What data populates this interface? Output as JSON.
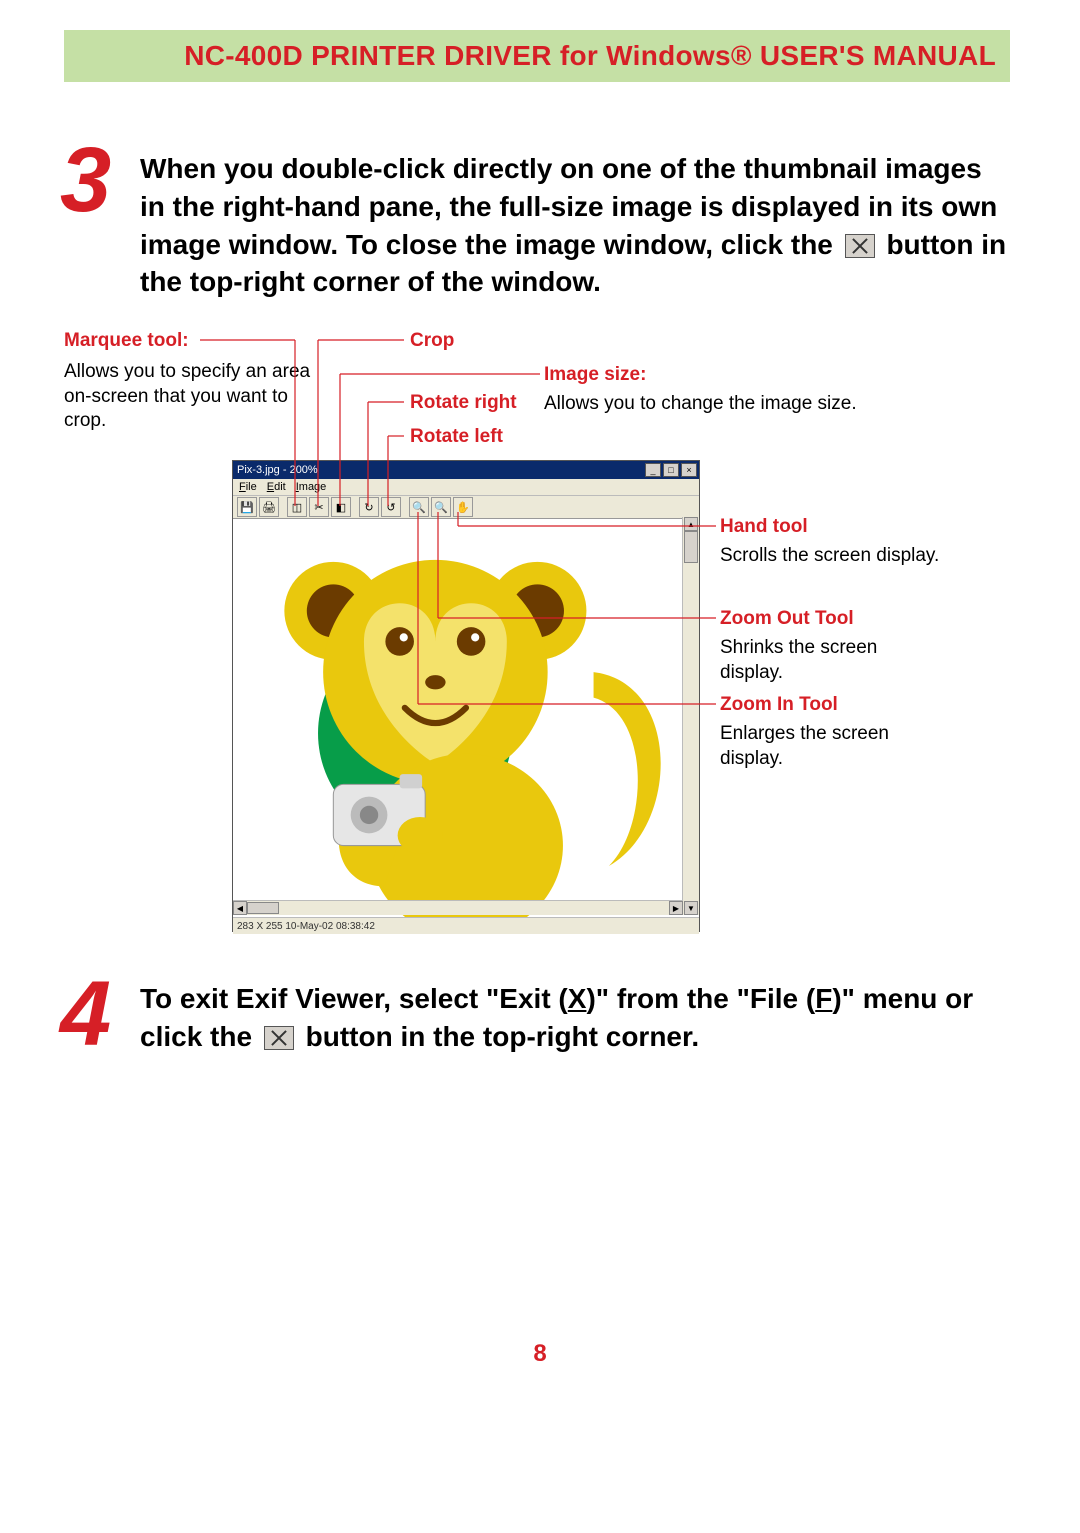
{
  "header": {
    "title": "NC-400D PRINTER DRIVER for Windows® USER'S MANUAL"
  },
  "step3": {
    "number": "3",
    "text_before_icon": "When you double-click directly on one of the thumbnail images in the right-hand pane, the full-size image is displayed in its own image window. To close the image window, click the ",
    "text_after_icon": " button in the top-right corner of the window."
  },
  "step4": {
    "number": "4",
    "text_prefix": "To exit Exif Viewer, select \"Exit (",
    "exit_key": "X",
    "text_mid1": ")\" from the \"File (",
    "file_key": "F",
    "text_mid2": ")\" menu or click the ",
    "text_suffix": " button in the top-right corner."
  },
  "labels": {
    "marquee": {
      "title": "Marquee tool:",
      "desc": "Allows you to specify an area on-screen that you want to crop."
    },
    "crop": {
      "title": "Crop"
    },
    "rotr": {
      "title": "Rotate right"
    },
    "rotl": {
      "title": "Rotate left"
    },
    "imgsize": {
      "title": "Image size:",
      "desc": "Allows you to change the image size."
    },
    "hand": {
      "title": "Hand tool",
      "desc": "Scrolls the screen display."
    },
    "zoomout": {
      "title": "Zoom Out Tool",
      "desc": "Shrinks the screen display."
    },
    "zoomin": {
      "title": "Zoom In Tool",
      "desc": "Enlarges the screen display."
    }
  },
  "window": {
    "title": "Pix-3.jpg - 200%",
    "menu": {
      "file": "File",
      "edit": "Edit",
      "image": "Image"
    },
    "status": "283 X 255   10-May-02 08:38:42",
    "winbtns": {
      "min": "_",
      "max": "□",
      "close": "×"
    }
  },
  "page_number": "8"
}
